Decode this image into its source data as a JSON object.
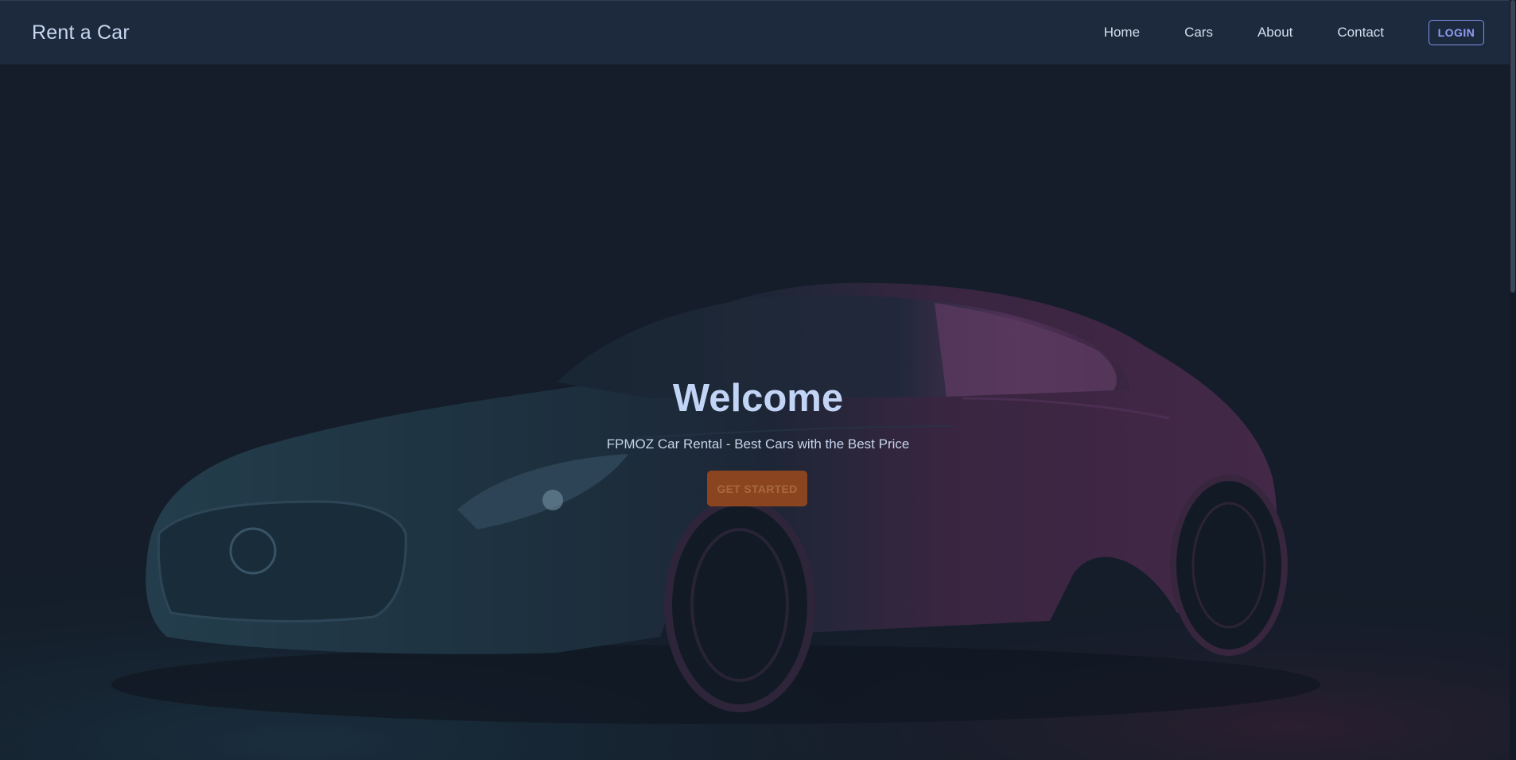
{
  "navbar": {
    "brand": "Rent a Car",
    "links": [
      {
        "label": "Home"
      },
      {
        "label": "Cars"
      },
      {
        "label": "About"
      },
      {
        "label": "Contact"
      }
    ],
    "login_label": "LOGIN"
  },
  "hero": {
    "title": "Welcome",
    "subtitle": "FPMOZ Car Rental - Best Cars with the Best Price",
    "cta_label": "GET STARTED",
    "background_image": "sports-car-photo"
  },
  "colors": {
    "navbar_bg": "#1d2a3d",
    "page_bg": "#161f2c",
    "accent": "#8e9cf5",
    "cta_bg": "#8a4520",
    "title_text": "#c3d5f7"
  }
}
